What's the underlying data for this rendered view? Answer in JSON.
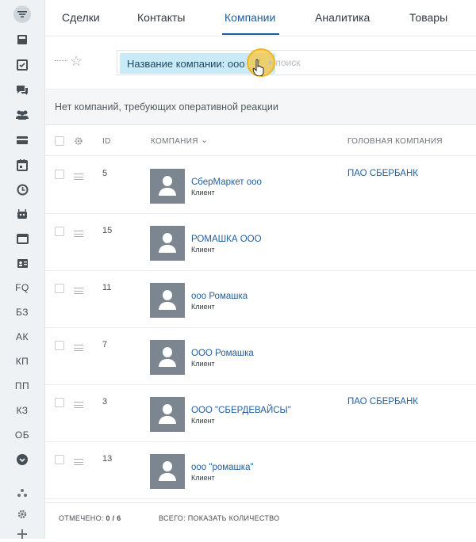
{
  "sidebar": {
    "icons": [
      "filter-icon",
      "book-icon",
      "checklist-icon",
      "chat-icon",
      "users-icon",
      "card-icon",
      "calendar-icon",
      "clock-icon",
      "robot-icon",
      "window-icon",
      "contact-card-icon"
    ],
    "text_items": [
      "FQ",
      "БЗ",
      "АК",
      "КП",
      "ПП",
      "КЗ",
      "ОБ"
    ],
    "bottom_icons": [
      "chevron-circle-icon",
      "network-icon",
      "gear-icon",
      "plus-icon"
    ]
  },
  "tabs": [
    "Сделки",
    "Контакты",
    "Компании",
    "Аналитика",
    "Товары"
  ],
  "active_tab": "Компании",
  "filter": {
    "chip_label": "Название компании: ооо",
    "chip_close": "×",
    "search_placeholder": "+ поиск"
  },
  "notice": "Нет компаний, требующих оперативной реакции",
  "table": {
    "columns": {
      "id": "ID",
      "company": "КОМПАНИЯ",
      "company_caret": "⌄",
      "parent": "ГОЛОВНАЯ КОМПАНИЯ"
    },
    "rows": [
      {
        "id": "5",
        "name": "СберМаркет ооо",
        "type": "Клиент",
        "parent": "ПАО СБЕРБАНК"
      },
      {
        "id": "15",
        "name": "РОМАШКА ООО",
        "type": "Клиент",
        "parent": ""
      },
      {
        "id": "11",
        "name": "ооо Ромашка",
        "type": "Клиент",
        "parent": ""
      },
      {
        "id": "7",
        "name": "ООО Ромашка",
        "type": "Клиент",
        "parent": ""
      },
      {
        "id": "3",
        "name": "ООО \"СБЕРДЕВАЙСЫ\"",
        "type": "Клиент",
        "parent": "ПАО СБЕРБАНК"
      },
      {
        "id": "13",
        "name": "ооо \"ромашка\"",
        "type": "Клиент",
        "parent": ""
      }
    ]
  },
  "footer": {
    "selected_label": "ОТМЕЧЕНО:",
    "selected_value": "0 / 6",
    "total_label": "ВСЕГО:",
    "total_link": "ПОКАЗАТЬ КОЛИЧЕСТВО"
  }
}
